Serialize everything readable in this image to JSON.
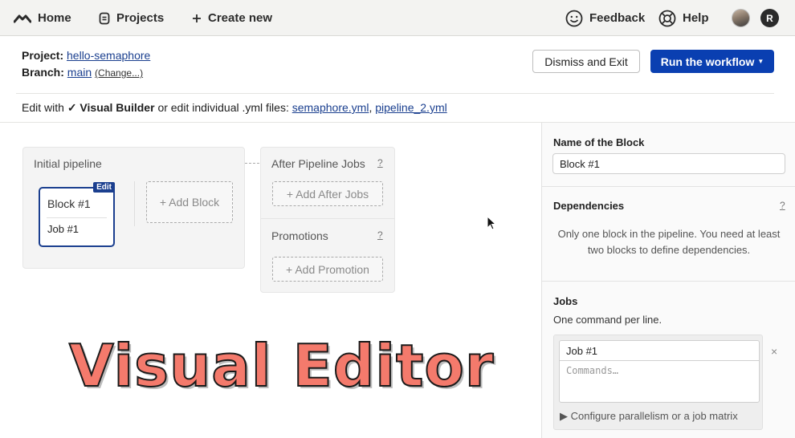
{
  "nav": {
    "home": "Home",
    "projects": "Projects",
    "create_new": "Create new",
    "feedback": "Feedback",
    "help": "Help",
    "user_initial": "R"
  },
  "header": {
    "project_label": "Project:",
    "project_name": "hello-semaphore",
    "branch_label": "Branch:",
    "branch_name": "main",
    "change_link": "(Change...)",
    "dismiss_button": "Dismiss and Exit",
    "run_button": "Run the workflow",
    "edit_prefix": "Edit with",
    "visual_builder": "✓ Visual Builder",
    "edit_middle": "or edit individual .yml files:",
    "file1": "semaphore.yml",
    "file_sep": ",",
    "file2": "pipeline_2.yml"
  },
  "canvas": {
    "initial_pipeline": "Initial pipeline",
    "block_name": "Block #1",
    "edit_tag": "Edit",
    "job_name": "Job #1",
    "add_block": "+ Add Block",
    "after_pipeline_jobs": "After Pipeline Jobs",
    "add_after_jobs": "+ Add After Jobs",
    "promotions": "Promotions",
    "add_promotion": "+ Add Promotion",
    "help_mark": "?"
  },
  "overlay_title": "Visual Editor",
  "sidebar": {
    "name_label": "Name of the Block",
    "name_value": "Block #1",
    "dependencies_label": "Dependencies",
    "dependencies_note": "Only one block in the pipeline. You need at least two blocks to define dependencies.",
    "help_mark": "?",
    "jobs_label": "Jobs",
    "jobs_hint": "One command per line.",
    "job_name_value": "Job #1",
    "commands_placeholder": "Commands…",
    "close_mark": "×",
    "config_link": "▶ Configure parallelism or a job matrix"
  },
  "colors": {
    "primary": "#0a3fb1",
    "overlay_fill": "#f47a6c"
  }
}
